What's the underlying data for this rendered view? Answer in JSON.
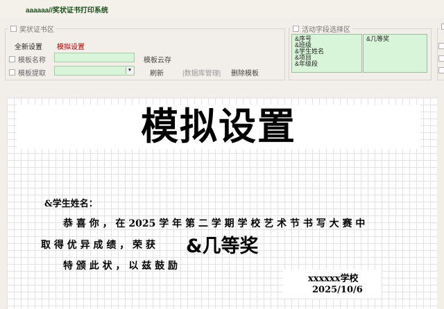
{
  "app_title": "aaaaaa//奖状证书打印系统",
  "left_group": {
    "caption": "奖状证书区",
    "reset_label": "全新设置",
    "simulate_label": "模拟设置",
    "template_name_label": "模板名称",
    "template_fetch_label": "模板提取",
    "template_name_value": "",
    "template_fetch_value": "",
    "save_template_label": "模板云存",
    "refresh_label": "刷新",
    "db_manage_label": "|数据库管理|",
    "delete_template_label": "删除模板"
  },
  "right_group": {
    "caption": "活动字段选择区",
    "fields_list": [
      "&序号",
      "&班级",
      "&学生姓名",
      "&项目",
      "&年级段"
    ],
    "award_list": [
      "&几等奖"
    ]
  },
  "certificate": {
    "title": "模拟设置",
    "student_field": "&学生姓名：",
    "line1": "恭 喜 你 ， 在 2025 学 年 第 二 学 期 学 校 艺 术 节 书 写 大 赛 中",
    "line2": "取 得 优 异 成 绩 ， 荣 获",
    "award_field": "&几等奖",
    "line3": "特 颁 此 状 ， 以 兹 鼓 励",
    "school": "xxxxxx学校",
    "date": "2025/10/6"
  }
}
